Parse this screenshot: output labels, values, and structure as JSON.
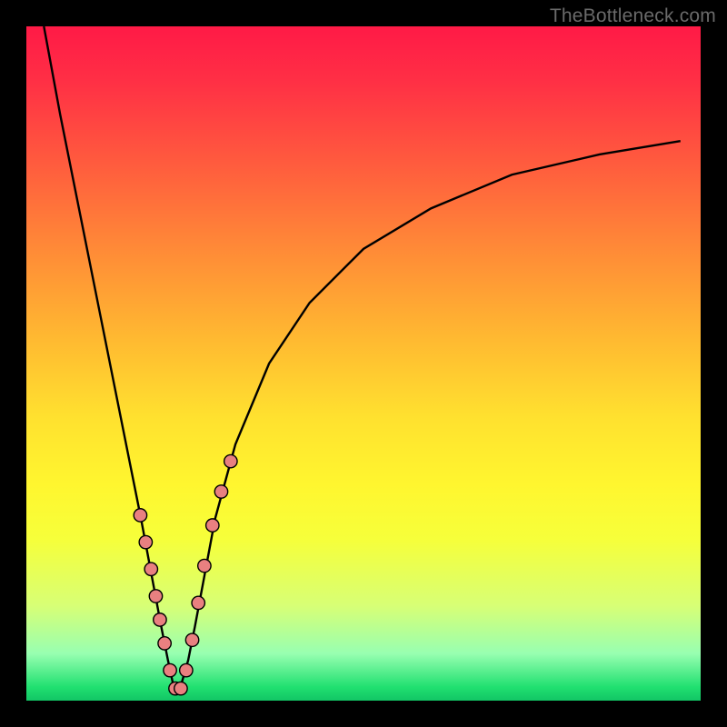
{
  "watermark": "TheBottleneck.com",
  "chart_data": {
    "type": "line",
    "title": "",
    "xlabel": "",
    "ylabel": "",
    "xlim": [
      0,
      1
    ],
    "ylim": [
      0,
      1
    ],
    "series": [
      {
        "name": "curve",
        "x": [
          0.026,
          0.05,
          0.08,
          0.11,
          0.14,
          0.17,
          0.185,
          0.2,
          0.21,
          0.219,
          0.228,
          0.24,
          0.25,
          0.265,
          0.28,
          0.31,
          0.36,
          0.42,
          0.5,
          0.6,
          0.72,
          0.85,
          0.97
        ],
        "y": [
          1.0,
          0.87,
          0.72,
          0.57,
          0.42,
          0.27,
          0.19,
          0.11,
          0.06,
          0.018,
          0.018,
          0.06,
          0.11,
          0.19,
          0.27,
          0.38,
          0.5,
          0.59,
          0.67,
          0.73,
          0.78,
          0.81,
          0.83
        ]
      }
    ],
    "markers": {
      "name": "highlight-points",
      "x": [
        0.169,
        0.177,
        0.185,
        0.192,
        0.198,
        0.205,
        0.213,
        0.221,
        0.229,
        0.237,
        0.246,
        0.255,
        0.264,
        0.276,
        0.289,
        0.303
      ],
      "y": [
        0.275,
        0.235,
        0.195,
        0.155,
        0.12,
        0.085,
        0.045,
        0.018,
        0.018,
        0.045,
        0.09,
        0.145,
        0.2,
        0.26,
        0.31,
        0.355
      ]
    },
    "colors": {
      "curve": "#000000",
      "marker_fill": "#e98080",
      "marker_stroke": "#000000",
      "gradient_top": "#ff1a46",
      "gradient_bottom": "#12c565"
    }
  }
}
